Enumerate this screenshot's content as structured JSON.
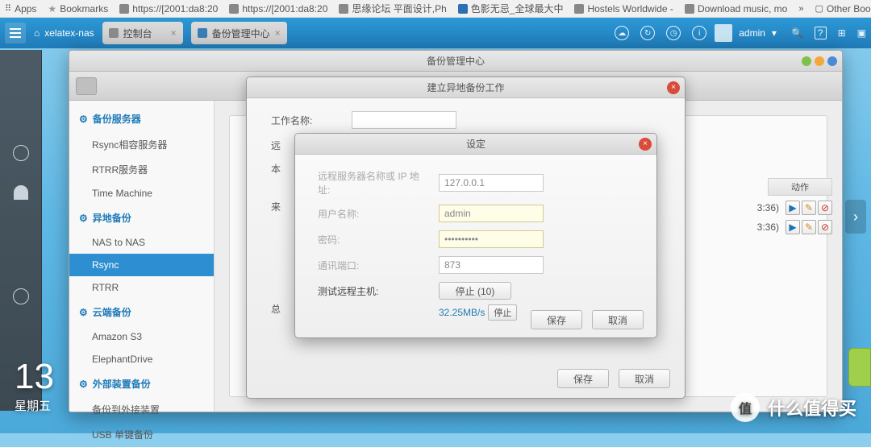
{
  "browser": {
    "apps": "Apps",
    "bookmarks_label": "Bookmarks",
    "bm1": "https://[2001:da8:20",
    "bm2": "https://[2001:da8:20",
    "bm3": "思缘论坛 平面设计,Ph",
    "bm4": "色影无忌_全球最大中",
    "bm5": "Hostels Worldwide -",
    "bm6": "Download music, mo",
    "other": "Other Bookmarks"
  },
  "nas": {
    "hostname": "xelatex-nas",
    "tab1": "控制台",
    "tab2": "备份管理中心",
    "user": "admin"
  },
  "app": {
    "title": "备份管理中心",
    "help": "?",
    "actions_header": "动作",
    "row_time": "3:36)"
  },
  "sidebar": {
    "g1": "备份服务器",
    "i1": "Rsync相容服务器",
    "i2": "RTRR服务器",
    "i3": "Time Machine",
    "g2": "异地备份",
    "i4": "NAS to NAS",
    "i5": "Rsync",
    "i6": "RTRR",
    "g3": "云端备份",
    "i7": "Amazon S3",
    "i8": "ElephantDrive",
    "g4": "外部装置备份",
    "i9": "备份到外接装置",
    "i10": "USB 单键备份"
  },
  "wizard": {
    "title": "建立异地备份工作",
    "job_name": "工作名称:",
    "remote_prefix": "远",
    "local_prefix": "本",
    "src_prefix": "来",
    "sum_prefix": "总",
    "save": "保存",
    "cancel": "取消"
  },
  "settings": {
    "title": "设定",
    "remote_label": "远程服务器名称或 IP 地址:",
    "remote_value": "127.0.0.1",
    "user_label": "用户名称:",
    "user_value": "admin",
    "pass_label": "密码:",
    "pass_value": "••••••••••",
    "port_label": "通讯端口:",
    "port_value": "873",
    "test_label": "测试远程主机:",
    "stop_btn": "停止 (10)",
    "speed": "32.25MB/s",
    "mini_stop": "停止",
    "save": "保存",
    "cancel": "取消"
  },
  "clock": {
    "time": "13",
    "day": "星期五"
  },
  "watermark": {
    "char": "值",
    "text": "什么值得买"
  }
}
